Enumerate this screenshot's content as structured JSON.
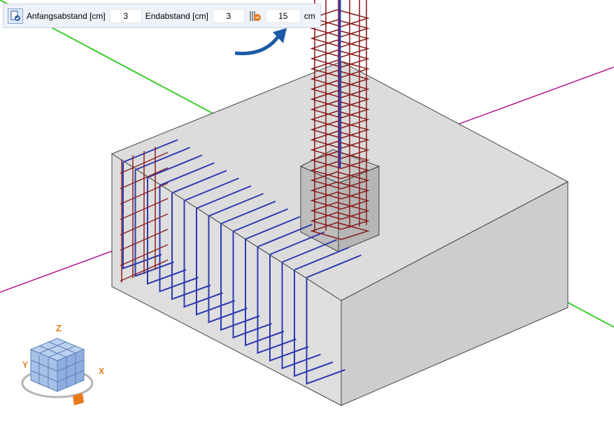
{
  "toolbar": {
    "start_label": "Anfangsabstand [cm]",
    "start_value": "3",
    "end_label": "Endabstand [cm]",
    "end_value": "3",
    "spacing_value": "15",
    "unit_label": "cm"
  },
  "nav_cube": {
    "axis_z": "Z",
    "axis_y": "Y",
    "axis_x": "X"
  },
  "colors": {
    "axis_green": "#3ccc30",
    "axis_magenta": "#b5148f",
    "rebar_red": "#8b2222",
    "rebar_blue": "#2c3ab0",
    "concrete_top": "#dadada",
    "concrete_side": "#c8c8c8",
    "accent_orange": "#e77a1a"
  }
}
